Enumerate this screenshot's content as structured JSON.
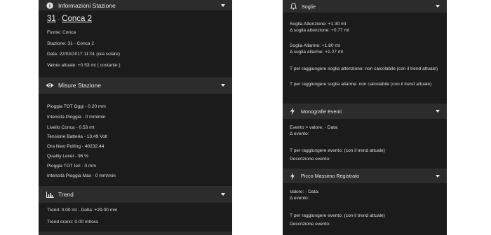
{
  "left": {
    "info": {
      "title": "Informazioni Stazione",
      "station_number": "31",
      "separator": "-",
      "station_name": "Conca 2",
      "fiume": "Fiume: Conca",
      "stazione": "Stazione: 31 - Conca 2",
      "data": "Data: 22/03/2017 11:01 (ora solare)",
      "valore": "Valore attuale: +0.53 mt ( costante )"
    },
    "misure": {
      "title": "Misure Stazione",
      "items": [
        "Pioggia TOT Oggi - 0.20 mm",
        "Intensità Pioggia - 0 mm/min",
        "Livello Conca - 0.53 mt",
        "Tensione Batteria - 13.49 Volt",
        "Ora Next Polling - 40232.44",
        "Quality Level - 96 %",
        "Pioggia TOT Ieri - 0 mm",
        "Intensità Pioggia Max - 0 mm/min"
      ]
    },
    "trend": {
      "title": "Trend",
      "trend_line": "Trend: 0.00 mt - Delta: +29.00 min",
      "orario_line": "Trend orario: 0.00 mt/ora"
    }
  },
  "right": {
    "soglie": {
      "title": "Soglie",
      "attenzione": "Soglia Attenzione: +1.30 mt",
      "delta_attenzione": "Δ soglia attenzione: +0.77 mt",
      "allarme": "Soglia Allarme: +1.80 mt",
      "delta_allarme": "Δ soglia allarme: +1.27 mt",
      "t_attenzione": "T per raggiungere soglia attenzione: non calcolabile (con il trend attuale)",
      "t_allarme": "T per raggiungere soglia allarme: non calcolabile (con il trend attuale)"
    },
    "monografie": {
      "title": "Monografie Eventi",
      "evento": "Evento > valore: - Data:",
      "delta_evento": "Δ evento:",
      "t_evento": "T per raggiungere evento: (con il trend attuale)",
      "descrizione": "Descrizione evento:"
    },
    "picco": {
      "title": "Picco Massimo Registrato",
      "valore": "Valore: - Data:",
      "delta_evento": "Δ evento:",
      "t_evento": "T per raggiungere evento: (con il trend attuale)",
      "descrizione": "Descrizione evento:"
    }
  },
  "icons": {
    "info": "info-circle-icon",
    "eye": "eye-icon",
    "chart": "bar-chart-icon",
    "bell": "bell-icon",
    "bolt": "lightning-bolt-icon",
    "chevron": "chevron-down-icon"
  }
}
